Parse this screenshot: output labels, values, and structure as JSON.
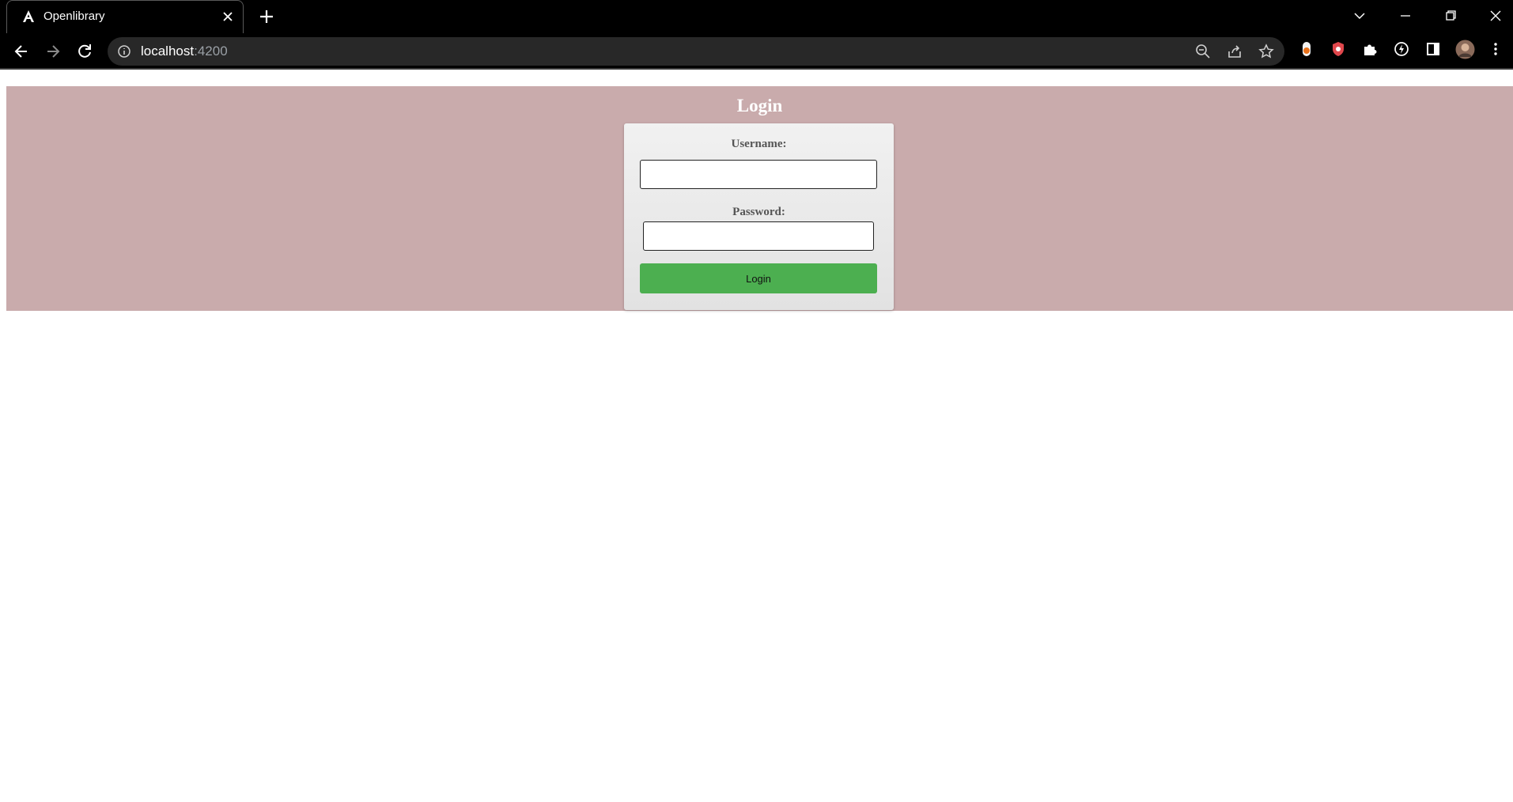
{
  "browser": {
    "tab": {
      "title": "Openlibrary",
      "favicon": "angular-logo-icon"
    },
    "url": {
      "host": "localhost",
      "port": ":4200"
    },
    "icons": [
      "zoom-icon",
      "share-icon",
      "bookmark-star-icon",
      "extension-icons",
      "profile-avatar"
    ]
  },
  "page": {
    "title": "Login",
    "background_color": "#c9abac",
    "form": {
      "username_label": "Username:",
      "username_value": "",
      "password_label": "Password:",
      "password_value": "",
      "submit_label": "Login",
      "submit_color": "#4caf50"
    }
  }
}
